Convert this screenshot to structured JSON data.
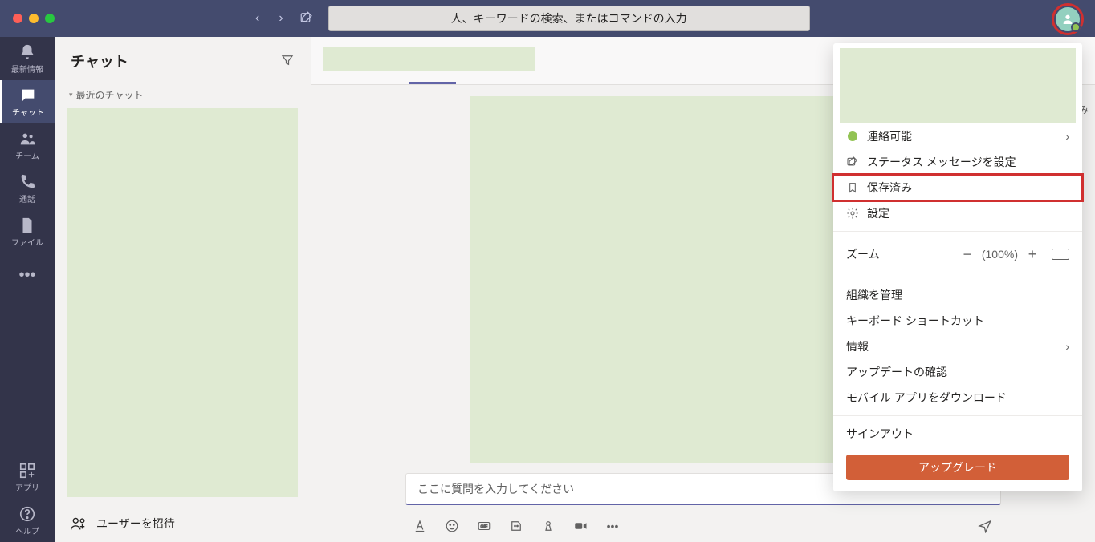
{
  "titlebar": {
    "search_placeholder": "人、キーワードの検索、またはコマンドの入力"
  },
  "rail": {
    "activity": "最新情報",
    "chat": "チャット",
    "teams": "チーム",
    "calls": "通話",
    "files": "ファイル",
    "apps": "アプリ",
    "help": "ヘルプ"
  },
  "chat_panel": {
    "title": "チャット",
    "recent_label": "最近のチャット",
    "invite_label": "ユーザーを招待"
  },
  "conversation": {
    "side_label": "とみ"
  },
  "composer": {
    "placeholder": "ここに質問を入力してください"
  },
  "profile_menu": {
    "available": "連絡可能",
    "set_status": "ステータス メッセージを設定",
    "saved": "保存済み",
    "settings": "設定",
    "zoom_label": "ズーム",
    "zoom_value": "(100%)",
    "manage_org": "組織を管理",
    "keyboard": "キーボード ショートカット",
    "about": "情報",
    "check_updates": "アップデートの確認",
    "download_mobile": "モバイル アプリをダウンロード",
    "sign_out": "サインアウト",
    "upgrade": "アップグレード"
  }
}
